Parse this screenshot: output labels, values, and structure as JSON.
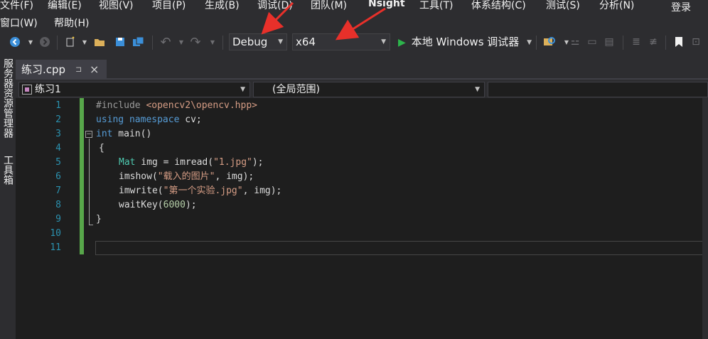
{
  "menubar": {
    "items": [
      "文件(F)",
      "编辑(E)",
      "视图(V)",
      "项目(P)",
      "生成(B)",
      "调试(D)",
      "团队(M)",
      "Nsight",
      "工具(T)",
      "体系结构(C)",
      "测试(S)",
      "分析(N)"
    ],
    "row2": [
      "窗口(W)",
      "帮助(H)"
    ],
    "login": "登录"
  },
  "toolbar": {
    "config": "Debug",
    "platform": "x64",
    "run_label": "本地 Windows 调试器"
  },
  "sidebar": {
    "panel1": "服务器资源管理器",
    "panel2": "工具箱"
  },
  "tab": {
    "title": "练习.cpp",
    "pin": "⊐",
    "close": "×"
  },
  "navbar": {
    "project": "练习1",
    "scope": "(全局范围)"
  },
  "editor": {
    "line_numbers": [
      "1",
      "2",
      "3",
      "4",
      "5",
      "6",
      "7",
      "8",
      "9",
      "10",
      "11"
    ]
  },
  "code": {
    "l1_pp": "#include ",
    "l1_inc": "<opencv2\\opencv.hpp>",
    "l2_kw1": "using",
    "l2_kw2": "namespace",
    "l2_rest": " cv;",
    "l3_kw": "int",
    "l3_rest": " main()",
    "l4": "{",
    "l5_ty": "Mat",
    "l5_a": " img = imread(",
    "l5_str": "\"1.jpg\"",
    "l5_b": ");",
    "l6_a": "imshow(",
    "l6_str": "\"载入的图片\"",
    "l6_b": ", img);",
    "l7_a": "imwrite(",
    "l7_str": "\"第一个实验.jpg\"",
    "l7_b": ", img);",
    "l8_a": "waitKey(",
    "l8_num": "6000",
    "l8_b": ");",
    "l9": "}"
  },
  "colors": {
    "accent_arrow": "#e8302a",
    "run_green": "#2db44b"
  }
}
